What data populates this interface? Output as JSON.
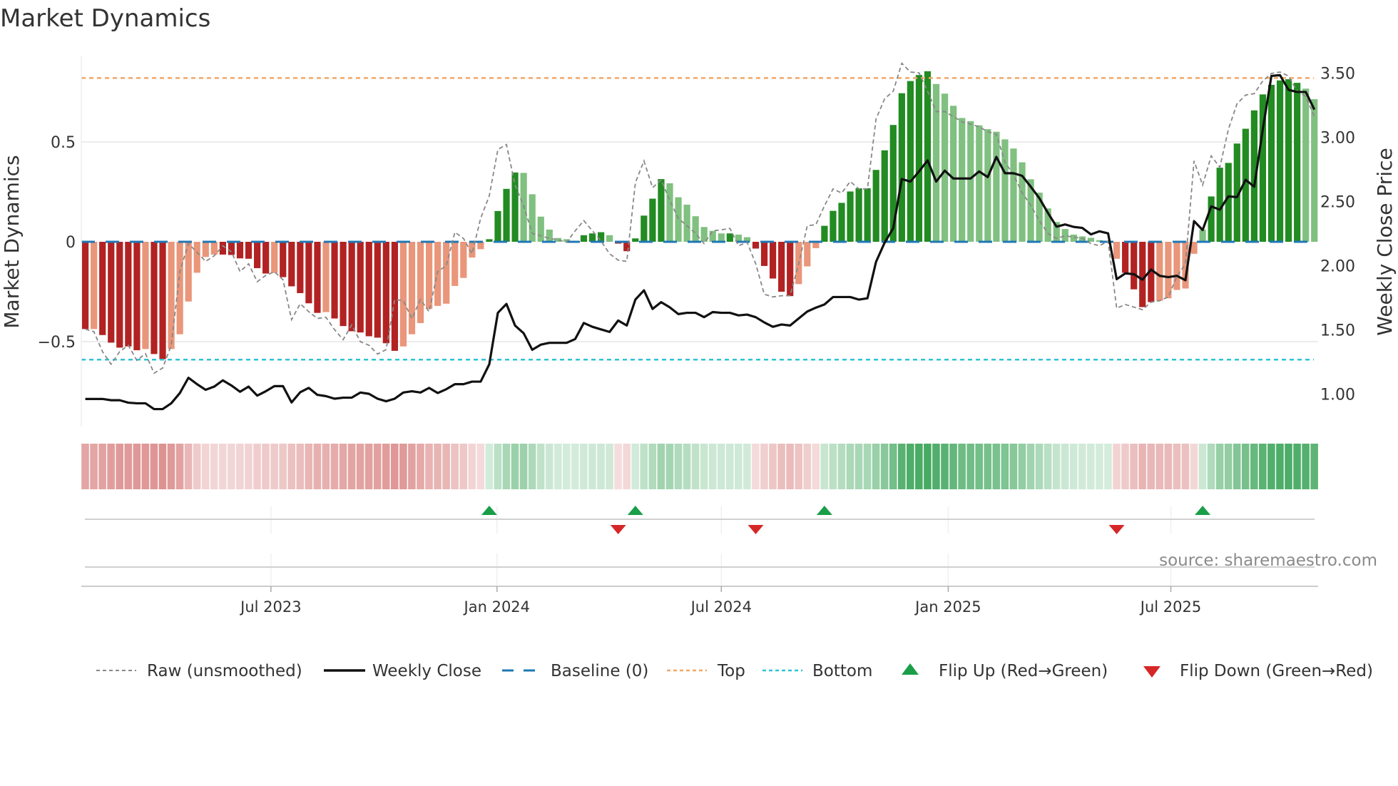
{
  "title": "Market Dynamics",
  "source": "source: sharemaestro.com",
  "chart_data": {
    "type": "bar",
    "title": "Market Dynamics",
    "ylabel": "Market Dynamics",
    "y2label": "Weekly Close Price",
    "ylim": [
      -0.9,
      0.98
    ],
    "y2lim": [
      0.72,
      3.65
    ],
    "yticks": [
      {
        "v": 0.5,
        "label": "0.5"
      },
      {
        "v": 0,
        "label": "0"
      },
      {
        "v": -0.5,
        "label": "−0.5"
      }
    ],
    "y2ticks": [
      {
        "v": 3.5,
        "label": "3.50"
      },
      {
        "v": 3.0,
        "label": "3.00"
      },
      {
        "v": 2.5,
        "label": "2.50"
      },
      {
        "v": 2.0,
        "label": "2.00"
      },
      {
        "v": 1.5,
        "label": "1.50"
      },
      {
        "v": 1.0,
        "label": "1.00"
      }
    ],
    "xticks": [
      {
        "week": 21.6,
        "label": "Jul 2023"
      },
      {
        "week": 47.9,
        "label": "Jan 2024"
      },
      {
        "week": 74.0,
        "label": "Jul 2024"
      },
      {
        "week": 100.4,
        "label": "Jan 2025"
      },
      {
        "week": 126.3,
        "label": "Jul 2025"
      }
    ],
    "top_level": 0.82,
    "bottom_level": -0.59,
    "baseline": 0,
    "values": [
      -0.437,
      -0.437,
      -0.467,
      -0.505,
      -0.53,
      -0.524,
      -0.543,
      -0.537,
      -0.562,
      -0.588,
      -0.537,
      -0.463,
      -0.299,
      -0.155,
      -0.076,
      -0.064,
      -0.064,
      -0.066,
      -0.083,
      -0.085,
      -0.132,
      -0.159,
      -0.156,
      -0.177,
      -0.223,
      -0.257,
      -0.308,
      -0.356,
      -0.352,
      -0.384,
      -0.422,
      -0.448,
      -0.454,
      -0.473,
      -0.48,
      -0.508,
      -0.546,
      -0.524,
      -0.463,
      -0.407,
      -0.336,
      -0.321,
      -0.31,
      -0.221,
      -0.181,
      -0.079,
      -0.037,
      0.013,
      0.154,
      0.265,
      0.347,
      0.345,
      0.238,
      0.126,
      0.061,
      0.019,
      0.013,
      0.005,
      0.033,
      0.042,
      0.048,
      0.033,
      -0.009,
      -0.047,
      0.017,
      0.131,
      0.216,
      0.314,
      0.293,
      0.223,
      0.186,
      0.128,
      0.074,
      0.055,
      0.042,
      0.042,
      0.036,
      0.023,
      -0.034,
      -0.121,
      -0.184,
      -0.25,
      -0.272,
      -0.212,
      -0.123,
      -0.032,
      0.08,
      0.155,
      0.195,
      0.252,
      0.268,
      0.268,
      0.36,
      0.458,
      0.585,
      0.744,
      0.805,
      0.835,
      0.854,
      0.79,
      0.742,
      0.681,
      0.62,
      0.604,
      0.583,
      0.564,
      0.551,
      0.513,
      0.467,
      0.398,
      0.313,
      0.246,
      0.167,
      0.099,
      0.064,
      0.036,
      0.027,
      0.02,
      0.008,
      0.004,
      -0.085,
      -0.155,
      -0.238,
      -0.327,
      -0.302,
      -0.295,
      -0.283,
      -0.241,
      -0.234,
      -0.06,
      0.061,
      0.227,
      0.371,
      0.395,
      0.492,
      0.566,
      0.658,
      0.738,
      0.786,
      0.808,
      0.814,
      0.796,
      0.767,
      0.714
    ],
    "shades": "DLDDDDDLDDLLLLLLDDDDDDLDDDDDLDDDDDDDDLLLLLLLLLLDDDDLLLLLLLDDDLDDDDDDLLLLLLLDLLDDDDDLLLDDDDDDDDDDDDDLLLLLLLLLLLLLLLLLLLLLLDDDDLLLLLLDDDDDDDDDDDLLL",
    "raw": [
      -0.437,
      -0.45,
      -0.55,
      -0.613,
      -0.55,
      -0.518,
      -0.594,
      -0.56,
      -0.658,
      -0.632,
      -0.518,
      -0.149,
      -0.009,
      -0.053,
      -0.098,
      -0.07,
      -0.02,
      -0.05,
      -0.149,
      -0.11,
      -0.2,
      -0.168,
      -0.15,
      -0.19,
      -0.39,
      -0.31,
      -0.35,
      -0.384,
      -0.378,
      -0.44,
      -0.49,
      -0.416,
      -0.5,
      -0.518,
      -0.562,
      -0.54,
      -0.289,
      -0.295,
      -0.384,
      -0.289,
      -0.35,
      -0.149,
      -0.12,
      0.048,
      0.017,
      -0.06,
      0.118,
      0.23,
      0.462,
      0.487,
      0.284,
      0.18,
      0.042,
      0.03,
      0.017,
      0.01,
      -0.002,
      0.055,
      0.106,
      0.055,
      0.004,
      -0.06,
      -0.092,
      -0.098,
      0.296,
      0.405,
      0.271,
      0.31,
      0.207,
      0.118,
      0.08,
      0.042,
      -0.009,
      0.055,
      0.06,
      0.067,
      -0.02,
      -0.002,
      -0.11,
      -0.263,
      -0.276,
      -0.27,
      -0.27,
      -0.11,
      0.08,
      0.086,
      0.18,
      0.265,
      0.244,
      0.302,
      0.265,
      0.265,
      0.615,
      0.716,
      0.754,
      0.894,
      0.85,
      0.846,
      0.754,
      0.652,
      0.652,
      0.627,
      0.601,
      0.589,
      0.576,
      0.551,
      0.538,
      0.399,
      0.335,
      0.246,
      0.182,
      0.106,
      0.042,
      0.017,
      0.03,
      0.023,
      0.017,
      -0.009,
      -0.02,
      0.004,
      -0.333,
      -0.314,
      -0.327,
      -0.34,
      -0.302,
      -0.295,
      -0.276,
      -0.174,
      -0.11,
      0.405,
      0.284,
      0.43,
      0.373,
      0.564,
      0.691,
      0.735,
      0.742,
      0.805,
      0.843,
      0.85,
      0.83,
      0.754,
      0.728,
      0.627
    ],
    "weekly_close": [
      0.962,
      0.962,
      0.962,
      0.952,
      0.952,
      0.933,
      0.928,
      0.928,
      0.883,
      0.883,
      0.928,
      1.008,
      1.127,
      1.077,
      1.033,
      1.058,
      1.107,
      1.067,
      1.018,
      1.058,
      0.988,
      1.022,
      1.062,
      1.062,
      0.935,
      1.014,
      1.048,
      0.994,
      0.984,
      0.964,
      0.972,
      0.972,
      1.012,
      1.002,
      0.964,
      0.944,
      0.964,
      1.012,
      1.022,
      1.012,
      1.048,
      1.008,
      1.038,
      1.077,
      1.077,
      1.097,
      1.097,
      1.232,
      1.633,
      1.702,
      1.534,
      1.474,
      1.345,
      1.385,
      1.399,
      1.399,
      1.399,
      1.429,
      1.554,
      1.524,
      1.504,
      1.484,
      1.573,
      1.534,
      1.736,
      1.808,
      1.663,
      1.716,
      1.676,
      1.623,
      1.633,
      1.633,
      1.599,
      1.639,
      1.633,
      1.633,
      1.613,
      1.619,
      1.599,
      1.558,
      1.524,
      1.542,
      1.534,
      1.589,
      1.643,
      1.673,
      1.698,
      1.756,
      1.756,
      1.756,
      1.736,
      1.746,
      2.03,
      2.179,
      2.292,
      2.675,
      2.655,
      2.734,
      2.82,
      2.655,
      2.74,
      2.679,
      2.679,
      2.679,
      2.734,
      2.69,
      2.847,
      2.72,
      2.72,
      2.7,
      2.615,
      2.526,
      2.411,
      2.304,
      2.321,
      2.302,
      2.294,
      2.244,
      2.268,
      2.252,
      1.895,
      1.94,
      1.934,
      1.891,
      1.97,
      1.921,
      1.911,
      1.921,
      1.887,
      2.347,
      2.278,
      2.462,
      2.436,
      2.54,
      2.534,
      2.669,
      2.615,
      3.062,
      3.478,
      3.484,
      3.369,
      3.353,
      3.353,
      3.216
    ],
    "flips": [
      {
        "type": "up",
        "week": 47
      },
      {
        "type": "down",
        "week": 62
      },
      {
        "type": "up",
        "week": 64
      },
      {
        "type": "down",
        "week": 78
      },
      {
        "type": "up",
        "week": 86
      },
      {
        "type": "down",
        "week": 120
      },
      {
        "type": "up",
        "week": 130
      }
    ],
    "legend": [
      {
        "key": "raw",
        "label": "Raw (unsmoothed)"
      },
      {
        "key": "close",
        "label": "Weekly Close"
      },
      {
        "key": "baseline",
        "label": "Baseline (0)"
      },
      {
        "key": "top",
        "label": "Top"
      },
      {
        "key": "bottom",
        "label": "Bottom"
      },
      {
        "key": "flipup",
        "label": "Flip Up (Red→Green)"
      },
      {
        "key": "flipdown",
        "label": "Flip Down (Green→Red)"
      }
    ],
    "legend_position": "bottom",
    "colors": {
      "pos_dark": "#228b22",
      "pos_light": "#80c080",
      "neg_dark": "#b22222",
      "neg_light": "#e9967a",
      "heat_pos": "#2e9e4e",
      "heat_neg": "#cd5c5c",
      "raw": "#888888",
      "close": "#111111",
      "baseline": "#1f77b4",
      "top": "#f0a868",
      "bottom": "#2ec4d4",
      "flip_up": "#1a9e48",
      "flip_down": "#d62728",
      "grid": "#e6e6e6",
      "spine": "#cccccc"
    }
  }
}
